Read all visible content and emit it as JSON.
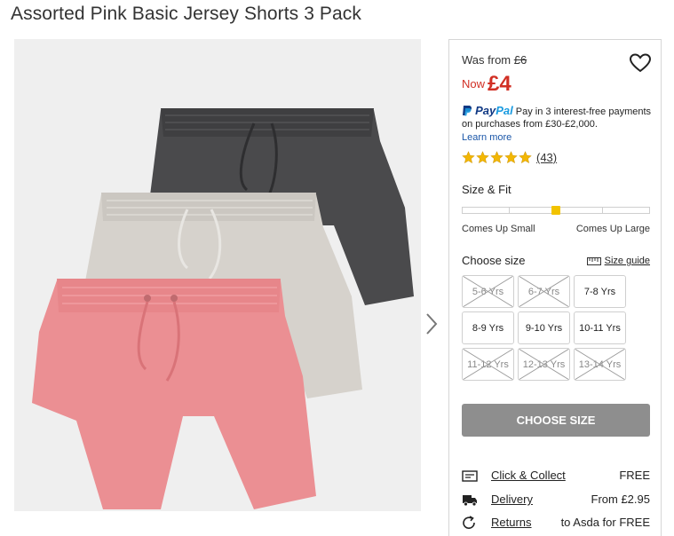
{
  "product": {
    "title": "Assorted Pink Basic Jersey Shorts 3 Pack"
  },
  "price": {
    "was_label": "Was from",
    "was_price": "£6",
    "now_label": "Now",
    "now_price": "£4"
  },
  "paypal": {
    "brand_a": "Pay",
    "brand_b": "Pal",
    "text": "Pay in 3 interest-free payments on purchases from £30-£2,000.",
    "link": "Learn more"
  },
  "rating": {
    "stars": 5,
    "count": "(43)"
  },
  "fit": {
    "title": "Size & Fit",
    "left_label": "Comes Up Small",
    "right_label": "Comes Up Large",
    "level": 0.5
  },
  "sizes": {
    "title": "Choose size",
    "guide_label": "Size guide",
    "options": [
      {
        "label": "5-6 Yrs",
        "available": false
      },
      {
        "label": "6-7 Yrs",
        "available": false
      },
      {
        "label": "7-8 Yrs",
        "available": true
      },
      {
        "label": "8-9 Yrs",
        "available": true
      },
      {
        "label": "9-10 Yrs",
        "available": true
      },
      {
        "label": "10-11 Yrs",
        "available": true
      },
      {
        "label": "11-12 Yrs",
        "available": false
      },
      {
        "label": "12-13 Yrs",
        "available": false
      },
      {
        "label": "13-14 Yrs",
        "available": false
      }
    ]
  },
  "cta": {
    "label": "CHOOSE SIZE"
  },
  "delivery": [
    {
      "icon": "click-collect-icon",
      "label": "Click & Collect",
      "value": "FREE"
    },
    {
      "icon": "delivery-truck-icon",
      "label": "Delivery",
      "value": "From £2.95"
    },
    {
      "icon": "returns-icon",
      "label": "Returns",
      "value": "to Asda for FREE"
    }
  ],
  "colors": {
    "price_red": "#d12f24",
    "fit_marker": "#f2c300",
    "cta_grey": "#8e8e8e",
    "paypal_dark": "#113984",
    "paypal_light": "#1a9be0"
  }
}
